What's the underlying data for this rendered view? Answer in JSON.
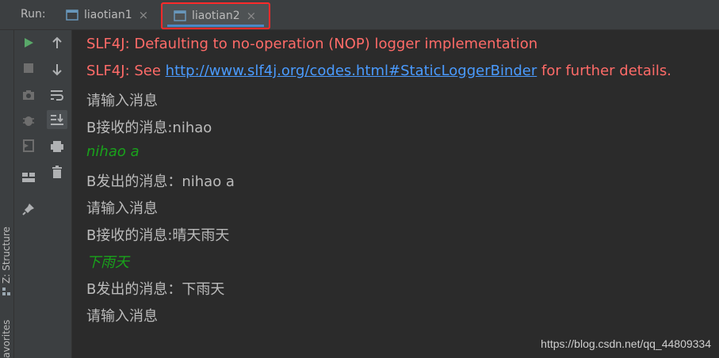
{
  "toolbar": {
    "run_label": "Run:",
    "tabs": [
      {
        "label": "liaotian1",
        "close": "×"
      },
      {
        "label": "liaotian2",
        "close": "×"
      }
    ]
  },
  "side_labels": {
    "structure": "Z: Structure",
    "favorites": "avorites"
  },
  "console": {
    "lines": [
      {
        "type": "err",
        "text": "SLF4J: Defaulting to no-operation (NOP) logger implementation"
      },
      {
        "type": "err_link",
        "prefix": "SLF4J: See ",
        "link": "http://www.slf4j.org/codes.html#StaticLoggerBinder",
        "suffix": " for further details."
      },
      {
        "type": "out",
        "text": "请输入消息"
      },
      {
        "type": "out",
        "text": "B接收的消息:nihao"
      },
      {
        "type": "input",
        "text": "nihao a"
      },
      {
        "type": "out",
        "text": "B发出的消息：nihao a"
      },
      {
        "type": "out",
        "text": "请输入消息"
      },
      {
        "type": "out",
        "text": "B接收的消息:晴天雨天"
      },
      {
        "type": "input",
        "text": "下雨天"
      },
      {
        "type": "out",
        "text": "B发出的消息：下雨天"
      },
      {
        "type": "out",
        "text": "请输入消息"
      }
    ]
  },
  "watermark": "https://blog.csdn.net/qq_44809334",
  "colors": {
    "error": "#ff6b68",
    "link": "#4a9bff",
    "input": "#19a21b",
    "highlight_border": "#ff2a2a",
    "tab_underline": "#4a88c7"
  }
}
